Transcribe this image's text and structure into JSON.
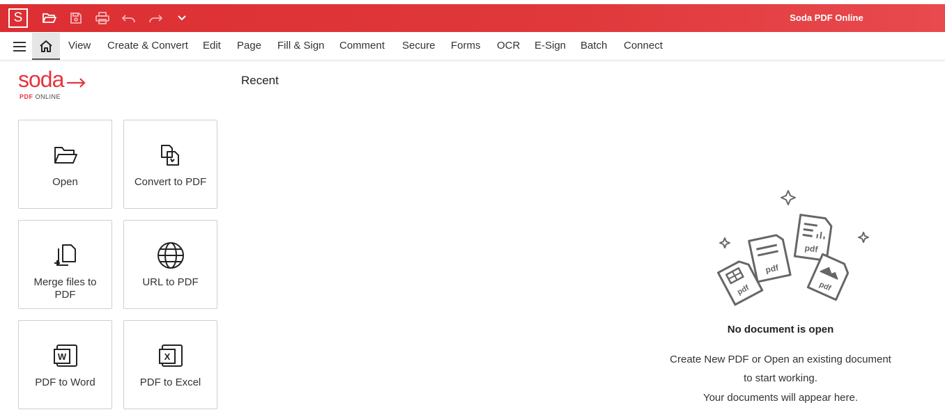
{
  "app": {
    "logo_letter": "S",
    "window_title": "Soda PDF Online",
    "brand_color": "#e0383b"
  },
  "quick_access": [
    {
      "name": "open-icon"
    },
    {
      "name": "save-icon"
    },
    {
      "name": "print-icon"
    },
    {
      "name": "undo-icon"
    },
    {
      "name": "redo-icon"
    },
    {
      "name": "chevron-down-icon"
    }
  ],
  "menu": {
    "home_icon": "home-icon",
    "items": [
      "View",
      "Create & Convert",
      "Edit",
      "Page",
      "Fill & Sign",
      "Comment",
      "Secure",
      "Forms",
      "OCR",
      "E-Sign",
      "Batch",
      "Connect"
    ]
  },
  "logo": {
    "word": "soda",
    "pdf": "PDF",
    "online": "ONLINE"
  },
  "tiles": [
    {
      "label": "Open",
      "icon": "folder-open-icon"
    },
    {
      "label": "Convert to PDF",
      "icon": "convert-icon"
    },
    {
      "label": "Merge files to PDF",
      "icon": "merge-icon"
    },
    {
      "label": "URL to PDF",
      "icon": "globe-icon"
    },
    {
      "label": "PDF to Word",
      "icon": "word-icon"
    },
    {
      "label": "PDF to Excel",
      "icon": "excel-icon"
    }
  ],
  "main": {
    "recent_heading": "Recent",
    "empty_title": "No document is open",
    "empty_line1": "Create New PDF or Open an existing document",
    "empty_line2": "to start working.",
    "empty_line3": "Your documents will appear here."
  }
}
